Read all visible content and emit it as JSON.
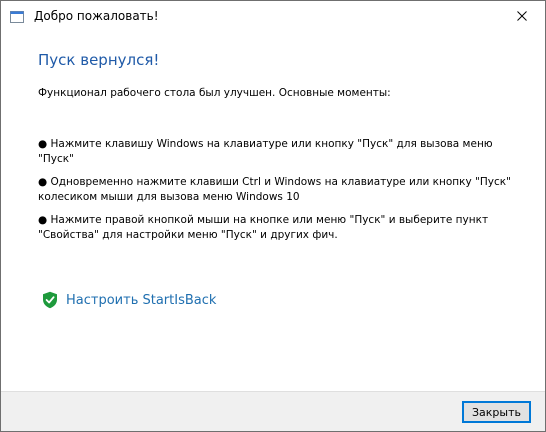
{
  "window": {
    "title": "Добро пожаловать!"
  },
  "main": {
    "heading": "Пуск вернулся!",
    "intro": "Функционал рабочего стола был улучшен. Основные моменты:",
    "bullets": [
      "● Нажмите клавишу Windows на клавиатуре или кнопку \"Пуск\" для вызова меню \"Пуск\"",
      "● Одновременно нажмите клавиши Ctrl и Windows на клавиатуре или кнопку \"Пуск\" колесиком мыши для вызова меню Windows 10",
      "● Нажмите правой кнопкой мыши на кнопке или меню \"Пуск\" и выберите пункт \"Свойства\" для настройки меню \"Пуск\" и других фич."
    ],
    "configure_link": "Настроить StartIsBack"
  },
  "footer": {
    "close_label": "Закрыть"
  },
  "icons": {
    "title": "window-icon",
    "close": "close-icon",
    "shield": "shield-check-icon"
  },
  "colors": {
    "heading": "#1f5aa8",
    "link": "#1f6fb0",
    "shield": "#1e9a3c",
    "button_border": "#0078d7"
  }
}
